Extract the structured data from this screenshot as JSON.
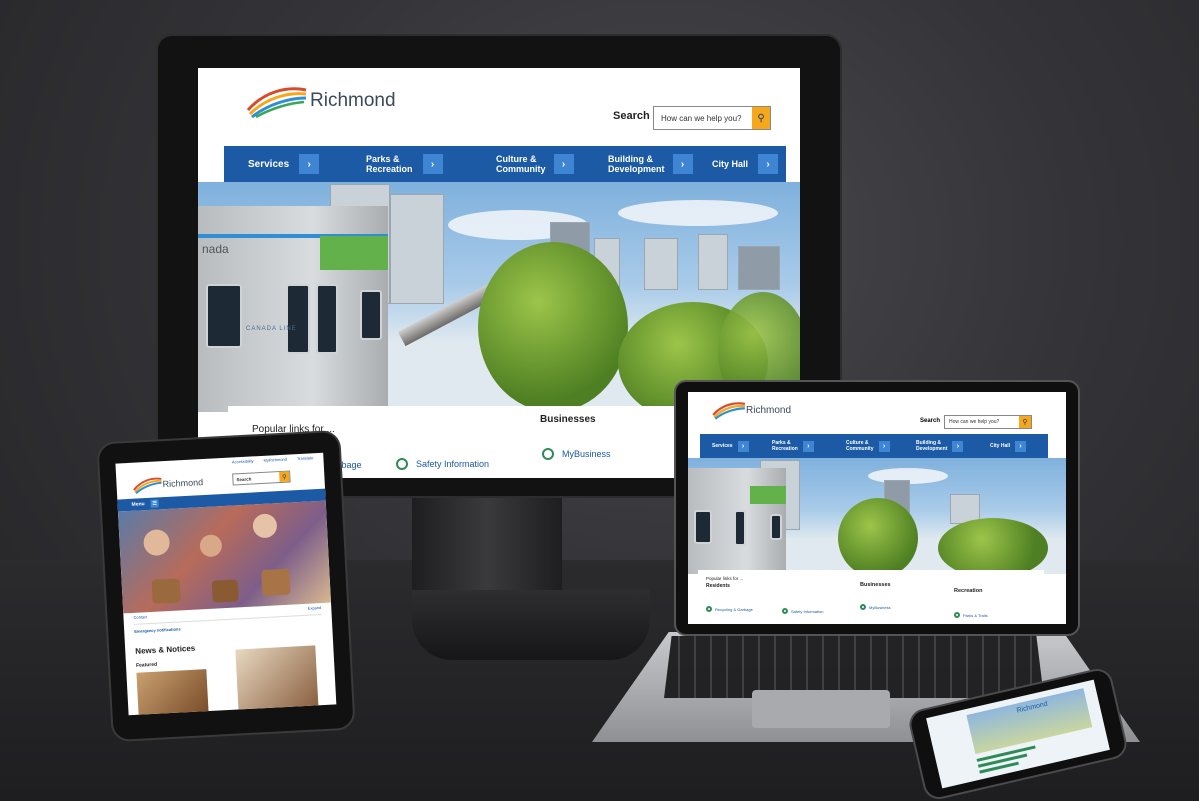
{
  "site": {
    "brand": "Richmond",
    "search_label": "Search",
    "search_placeholder": "How can we help you?",
    "nav": [
      {
        "line1": "Services",
        "line2": ""
      },
      {
        "line1": "Parks &",
        "line2": "Recreation"
      },
      {
        "line1": "Culture &",
        "line2": "Community"
      },
      {
        "line1": "Building &",
        "line2": "Development"
      },
      {
        "line1": "City Hall",
        "line2": ""
      }
    ],
    "train_text": "CANADA LINE",
    "train_brand": "nada",
    "popular_title": "Popular links for ...",
    "residents_heading": "Residents",
    "businesses_heading": "Businesses",
    "recreation_heading": "Recreation",
    "monitor_links": [
      "& Garbage",
      "Safety Information",
      "MyBusiness"
    ],
    "laptop_links": [
      "Recycling & Garbage",
      "Safety Information",
      "MyBusiness",
      "Parks & Trails"
    ]
  },
  "tablet": {
    "utility_links": [
      "Accessibility",
      "MyRichmond",
      "Translate"
    ],
    "search_label": "Search",
    "menu_label": "Menu",
    "contact_label": "Contact",
    "expand_label": "Expand",
    "emergency_label": "Emergency notifications",
    "news_heading": "News & Notices",
    "featured_label": "Featured"
  },
  "phone": {
    "brand": "Richmond"
  },
  "colors": {
    "nav_blue": "#1c5aa6",
    "search_accent": "#f5a81c",
    "link_green": "#2e8b57"
  }
}
